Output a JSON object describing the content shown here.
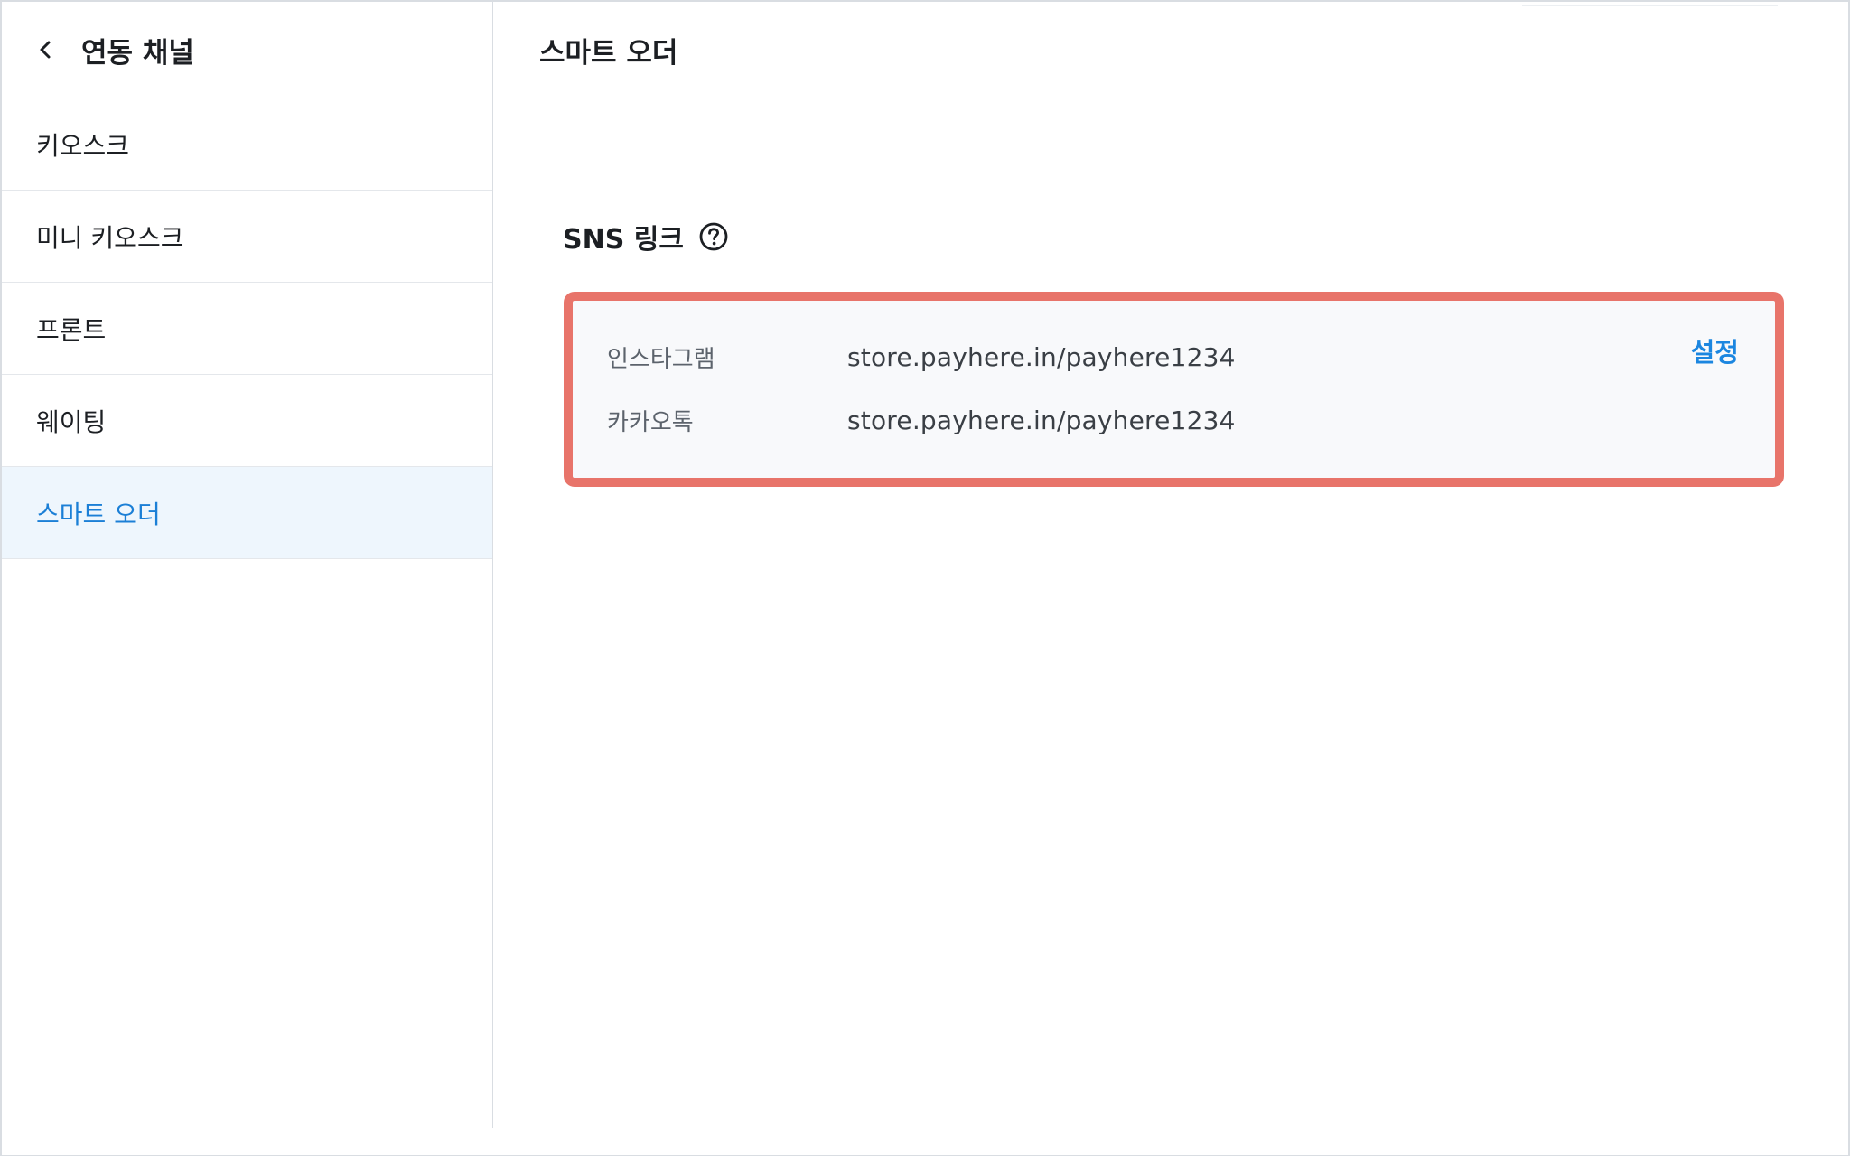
{
  "sidebar": {
    "title": "연동 채널",
    "back_icon": "chevron-left-icon",
    "items": [
      {
        "label": "키오스크",
        "active": false
      },
      {
        "label": "미니 키오스크",
        "active": false
      },
      {
        "label": "프론트",
        "active": false
      },
      {
        "label": "웨이팅",
        "active": false
      },
      {
        "label": "스마트 오더",
        "active": true
      }
    ]
  },
  "main": {
    "title": "스마트 오더",
    "section": {
      "title": "SNS 링크",
      "help_icon": "help-circle-icon",
      "settings_label": "설정",
      "links": [
        {
          "label": "인스타그램",
          "value": "store.payhere.in/payhere1234"
        },
        {
          "label": "카카오톡",
          "value": "store.payhere.in/payhere1234"
        }
      ]
    }
  },
  "colors": {
    "accent": "#1b86e0",
    "active_bg": "#eef6fd",
    "highlight_border": "#e8746a",
    "card_bg": "#f8f9fb",
    "divider": "#d9dde2"
  }
}
